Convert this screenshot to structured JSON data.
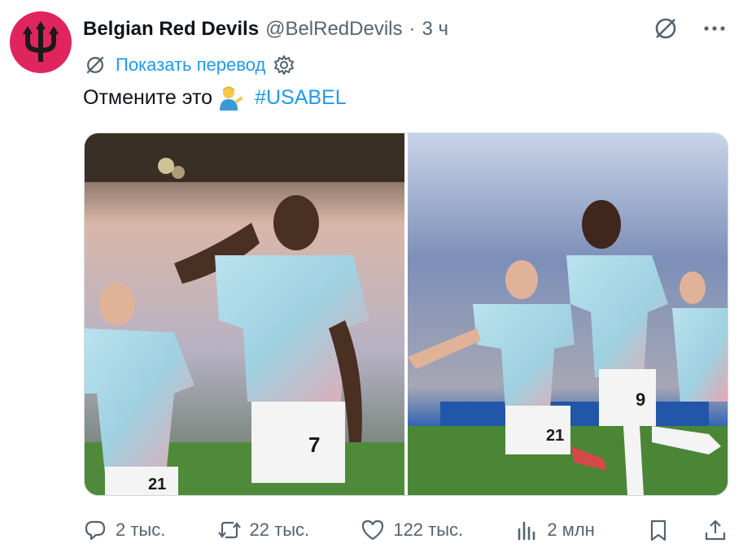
{
  "tweet": {
    "author_name": "Belgian Red Devils",
    "handle": "@BelRedDevils",
    "separator": "·",
    "time": "3 ч",
    "translate_label": "Показать перевод",
    "text": "Отмените это",
    "hashtag": "#USABEL",
    "emoji": "man-tipping-hand-emoji"
  },
  "media": {
    "photo_left": {
      "jersey_main": "7",
      "jersey_side": "21",
      "description_icon": "celebrating-player-photo"
    },
    "photo_right": {
      "jersey_main": "9",
      "jersey_side": "21",
      "description_icon": "players-running-photo"
    }
  },
  "actions": {
    "replies": "2 тыс.",
    "retweets": "22 тыс.",
    "likes": "122 тыс.",
    "views": "2 млн"
  },
  "colors": {
    "accent": "#1d9bf0",
    "muted": "#536471",
    "avatar_bg": "#e0245e",
    "jersey": "#a8d8e6"
  }
}
